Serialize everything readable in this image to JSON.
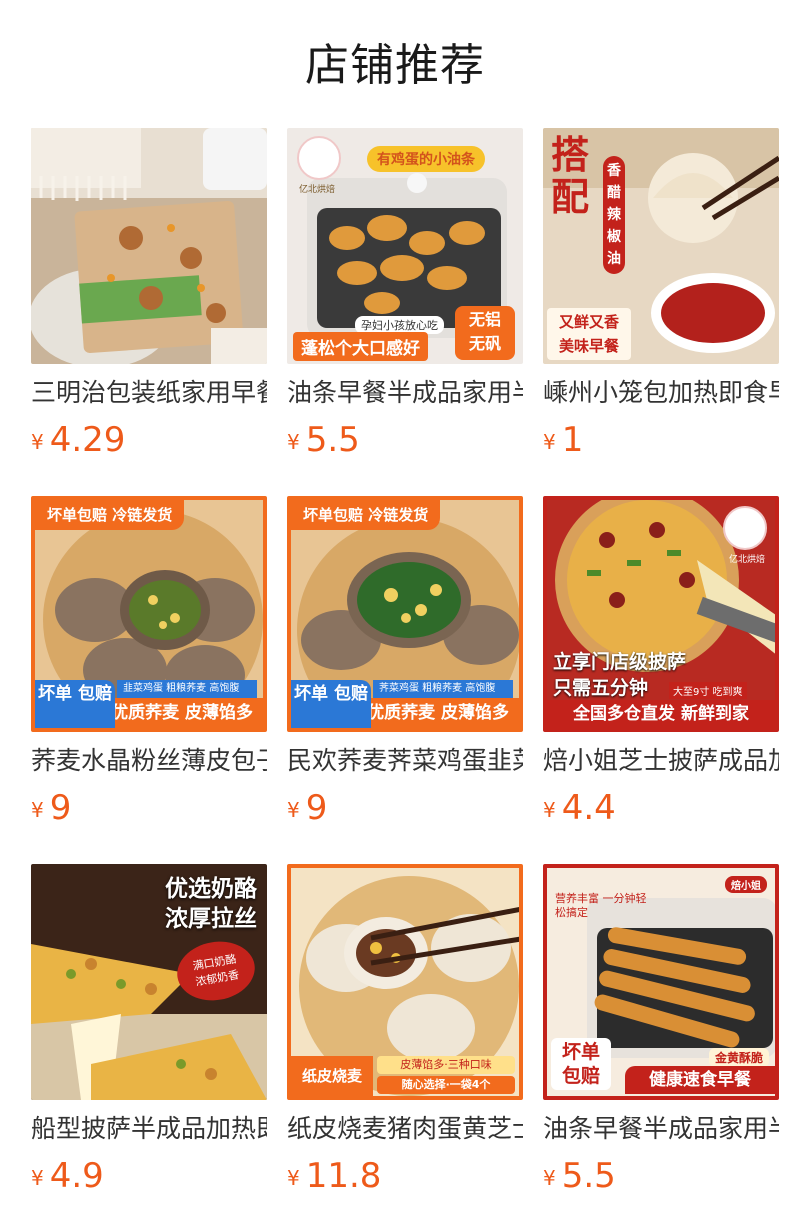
{
  "header": {
    "title": "店铺推荐"
  },
  "currency": "¥",
  "colors": {
    "price": "#ee5a1a",
    "accent": "#f26b1d",
    "badge_blue": "#2b78d6"
  },
  "products": [
    {
      "name": "三明治包装纸家用早餐",
      "price": "4.29",
      "image_text": {}
    },
    {
      "name": "油条早餐半成品家用半成品",
      "price": "5.5",
      "image_text": {
        "banner": "有鸡蛋的小油条",
        "logo": "亿北烘焙",
        "line1": "孕妇小孩放心吃",
        "line2": "蓬松个大口感好",
        "badge1": "无铝",
        "badge2": "无矾"
      }
    },
    {
      "name": "嵊州小笼包加热即食早餐",
      "price": "1",
      "image_text": {
        "big": "搭配",
        "side": "香醋辣椒油",
        "bottom": "又鲜又香 美味早餐"
      }
    },
    {
      "name": "荞麦水晶粉丝薄皮包子",
      "price": "9",
      "image_text": {
        "banner": "坏单包赔  冷链发货",
        "badge": "坏单 包赔",
        "strip": "韭菜鸡蛋  粗粮荞麦  高饱腹",
        "bottom": "优质荞麦  皮薄馅多"
      }
    },
    {
      "name": "民欢荞麦荠菜鸡蛋韭菜包",
      "price": "9",
      "image_text": {
        "banner": "坏单包赔  冷链发货",
        "badge": "坏单 包赔",
        "strip": "荠菜鸡蛋  粗粮荞麦  高饱腹",
        "bottom": "优质荞麦  皮薄馅多"
      }
    },
    {
      "name": "焙小姐芝士披萨成品加热",
      "price": "4.4",
      "image_text": {
        "logo": "亿北烘焙",
        "line1": "立享门店级披萨",
        "line2": "只需五分钟",
        "small": "大至9寸 吃到爽",
        "bottom": "全国多仓直发  新鲜到家"
      }
    },
    {
      "name": "船型披萨半成品加热即食",
      "price": "4.9",
      "image_text": {
        "line1": "优选奶酪",
        "line2": "浓厚拉丝",
        "bubble": "满口奶酪 浓郁奶香"
      }
    },
    {
      "name": "纸皮烧麦猪肉蛋黄芝士",
      "price": "11.8",
      "image_text": {
        "left": "纸皮烧麦",
        "right1": "皮薄馅多·三种口味",
        "right2": "随心选择·一袋4个"
      }
    },
    {
      "name": "油条早餐半成品家用半成品",
      "price": "5.5",
      "image_text": {
        "logo": "焙小姐",
        "top": "营养丰富 一分钟轻松搞定",
        "badge": "坏单 包赔",
        "tag": "金黄酥脆",
        "bottom": "健康速食早餐"
      }
    }
  ]
}
